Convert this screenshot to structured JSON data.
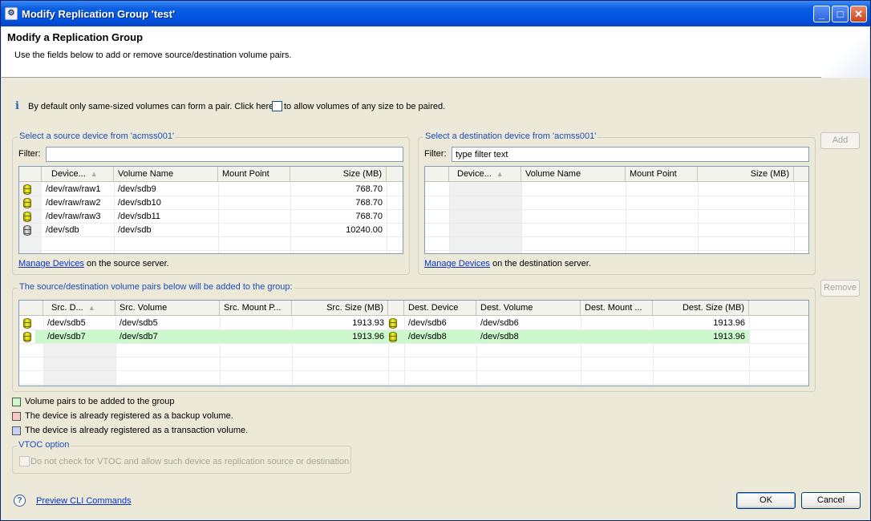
{
  "window": {
    "title": "Modify Replication Group 'test'",
    "minimize": "_",
    "maximize": "□",
    "close": "✕"
  },
  "header": {
    "title": "Modify a Replication Group",
    "description": "Use the fields below to add or remove source/destination volume pairs."
  },
  "info": {
    "text_before": "By default only same-sized volumes can form a pair. Click here",
    "text_after": "to allow volumes of any size to be paired.",
    "checked": false
  },
  "source": {
    "group_label": "Select a source device from 'acmss001'",
    "filter_label": "Filter:",
    "filter_value": "",
    "columns": [
      "Device...",
      "Volume Name",
      "Mount Point",
      "Size (MB)"
    ],
    "rows": [
      {
        "icon": "yellow",
        "device": "/dev/raw/raw1",
        "volume": "/dev/sdb9",
        "mount": "",
        "size": "768.70"
      },
      {
        "icon": "yellow",
        "device": "/dev/raw/raw2",
        "volume": "/dev/sdb10",
        "mount": "",
        "size": "768.70"
      },
      {
        "icon": "yellow",
        "device": "/dev/raw/raw3",
        "volume": "/dev/sdb11",
        "mount": "",
        "size": "768.70"
      },
      {
        "icon": "gray",
        "device": "/dev/sdb",
        "volume": "/dev/sdb",
        "mount": "",
        "size": "10240.00"
      }
    ],
    "manage_link": "Manage Devices",
    "manage_suffix": "on the source server."
  },
  "destination": {
    "group_label": "Select a destination device from 'acmss001'",
    "filter_label": "Filter:",
    "filter_value": "type filter text",
    "columns": [
      "Device...",
      "Volume Name",
      "Mount Point",
      "Size (MB)"
    ],
    "manage_link": "Manage Devices",
    "manage_suffix": "on the destination server."
  },
  "pairs": {
    "group_label": "The source/destination volume pairs below will be added to the group:",
    "columns": [
      "Src. D...",
      "Src. Volume",
      "Src. Mount P...",
      "Src. Size (MB)",
      "Dest. Device",
      "Dest. Volume",
      "Dest. Mount ...",
      "Dest. Size (MB)"
    ],
    "rows": [
      {
        "src_device": "/dev/sdb5",
        "src_volume": "/dev/sdb5",
        "src_mount": "",
        "src_size": "1913.93",
        "dest_device": "/dev/sdb6",
        "dest_volume": "/dev/sdb6",
        "dest_mount": "",
        "dest_size": "1913.96",
        "highlight": false
      },
      {
        "src_device": "/dev/sdb7",
        "src_volume": "/dev/sdb7",
        "src_mount": "",
        "src_size": "1913.96",
        "dest_device": "/dev/sdb8",
        "dest_volume": "/dev/sdb8",
        "dest_mount": "",
        "dest_size": "1913.96",
        "highlight": true
      }
    ]
  },
  "buttons": {
    "add": "Add",
    "remove": "Remove",
    "ok": "OK",
    "cancel": "Cancel"
  },
  "legend": [
    {
      "text": "Volume pairs to be added to the group",
      "color": "#cdf7cd"
    },
    {
      "text": "The device is already registered as a backup volume.",
      "color": "#f7c8c8"
    },
    {
      "text": "The device is already registered as a transaction volume.",
      "color": "#c8d0f5"
    }
  ],
  "vtoc": {
    "group_label": "VTOC option",
    "checkbox_label": "Do not check for VTOC and allow such device as replication source or destination",
    "checked": false
  },
  "footer": {
    "preview_link": "Preview CLI Commands",
    "help_glyph": "?"
  },
  "glyphs": {
    "info": "i",
    "sort_up": "▲"
  }
}
